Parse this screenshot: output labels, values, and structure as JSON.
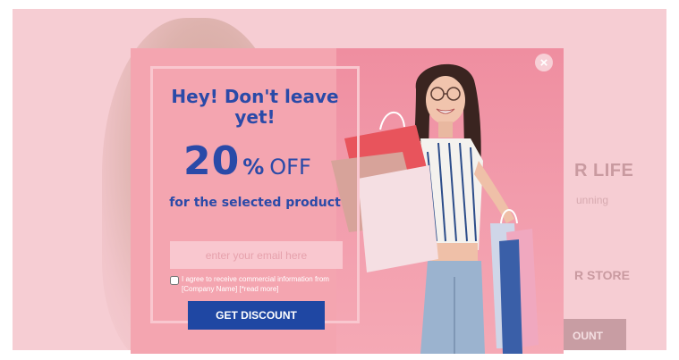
{
  "background_page": {
    "heading_fragment": "R LIFE",
    "sub_fragment": "unning",
    "store_fragment": "R STORE",
    "button_fragment": "OUNT"
  },
  "popup": {
    "close_label": "×",
    "headline": "Hey! Don't leave yet!",
    "discount_number": "20",
    "percent_sign": "%",
    "off_label": "OFF",
    "subline": "for the selected product",
    "email_placeholder": "enter your email here",
    "consent_text": "I agree to receive commercial information from [Company Name] [*read more]",
    "cta_label": "GET DISCOUNT"
  },
  "colors": {
    "brand_blue": "#2a4aa8",
    "cta_blue": "#1f47a3",
    "popup_pink": "#f4a5b0",
    "page_pink": "#f6cdd3"
  }
}
